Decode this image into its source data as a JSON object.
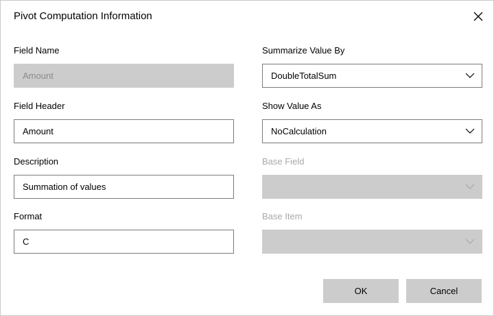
{
  "dialog": {
    "title": "Pivot Computation Information",
    "close_icon": "close-icon"
  },
  "fields": {
    "field_name": {
      "label": "Field Name",
      "value": "Amount"
    },
    "field_header": {
      "label": "Field Header",
      "value": "Amount"
    },
    "description": {
      "label": "Description",
      "value": "Summation of values"
    },
    "format": {
      "label": "Format",
      "value": "C"
    },
    "summarize_value_by": {
      "label": "Summarize Value By",
      "value": "DoubleTotalSum"
    },
    "show_value_as": {
      "label": "Show Value As",
      "value": "NoCalculation"
    },
    "base_field": {
      "label": "Base Field",
      "value": ""
    },
    "base_item": {
      "label": "Base Item",
      "value": ""
    }
  },
  "buttons": {
    "ok": "OK",
    "cancel": "Cancel"
  },
  "colors": {
    "disabled_fill": "#cccccc",
    "border": "#7a7a7a",
    "disabled_text": "#a8a8a8"
  }
}
